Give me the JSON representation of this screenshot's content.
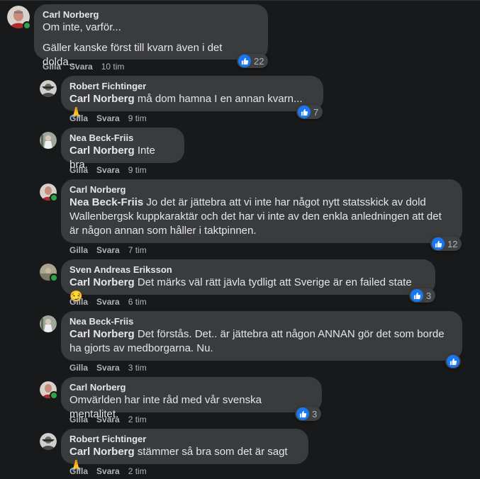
{
  "actions": {
    "like": "Gilla",
    "reply": "Svara"
  },
  "comments": [
    {
      "author": "Carl Norberg",
      "tag": "",
      "text": "Om inte, varför...",
      "text2": "Gäller kanske först till kvarn även i det dolda...",
      "time": "10 tim",
      "reactions": "22",
      "online": true,
      "avatar_icon": "avatar-carl"
    },
    {
      "author": "Robert Fichtinger",
      "tag": "Carl Norberg",
      "text": " må dom hamna I en annan kvarn...",
      "emoji": "🙏",
      "time": "9 tim",
      "reactions": "7",
      "online": false,
      "avatar_icon": "avatar-robert"
    },
    {
      "author": "Nea Beck-Friis",
      "tag": "Carl Norberg",
      "text": " Inte bra.",
      "time": "9 tim",
      "reactions": "",
      "online": false,
      "avatar_icon": "avatar-nea"
    },
    {
      "author": "Carl Norberg",
      "tag": "Nea Beck-Friis",
      "text": " Jo det är jättebra att vi inte har något nytt statsskick av dold Wallenbergsk kuppkaraktär och det har vi inte av den enkla anledningen att det är någon annan som håller i taktpinnen.",
      "time": "7 tim",
      "reactions": "12",
      "online": true,
      "avatar_icon": "avatar-carl"
    },
    {
      "author": "Sven Andreas Eriksson",
      "tag": "Carl Norberg",
      "text": " Det märks väl rätt jävla tydligt att Sverige är en failed state ",
      "emoji": "😏",
      "time": "6 tim",
      "reactions": "3",
      "online": true,
      "avatar_icon": "avatar-sven"
    },
    {
      "author": "Nea Beck-Friis",
      "tag": "Carl Norberg",
      "text": " Det förstås. Det.. är jättebra att någon ANNAN gör det som borde ha gjorts av medborgarna. Nu.",
      "time": "3 tim",
      "reactions": "",
      "online": false,
      "avatar_icon": "avatar-nea"
    },
    {
      "author": "Carl Norberg",
      "tag": "",
      "text": "Omvärlden har inte råd med vår svenska mentalitet.",
      "time": "2 tim",
      "reactions": "3",
      "online": true,
      "avatar_icon": "avatar-carl"
    },
    {
      "author": "Robert Fichtinger",
      "tag": "Carl Norberg",
      "text": " stämmer så bra som det är sagt",
      "emoji": "🙏",
      "time": "2 tim",
      "reactions": "",
      "online": false,
      "avatar_icon": "avatar-robert"
    }
  ],
  "colors": {
    "background": "#18191a",
    "bubble": "#3a3b3c",
    "like_blue": "#1877f2",
    "online_green": "#31a24c",
    "muted_text": "#b0b3b8"
  }
}
